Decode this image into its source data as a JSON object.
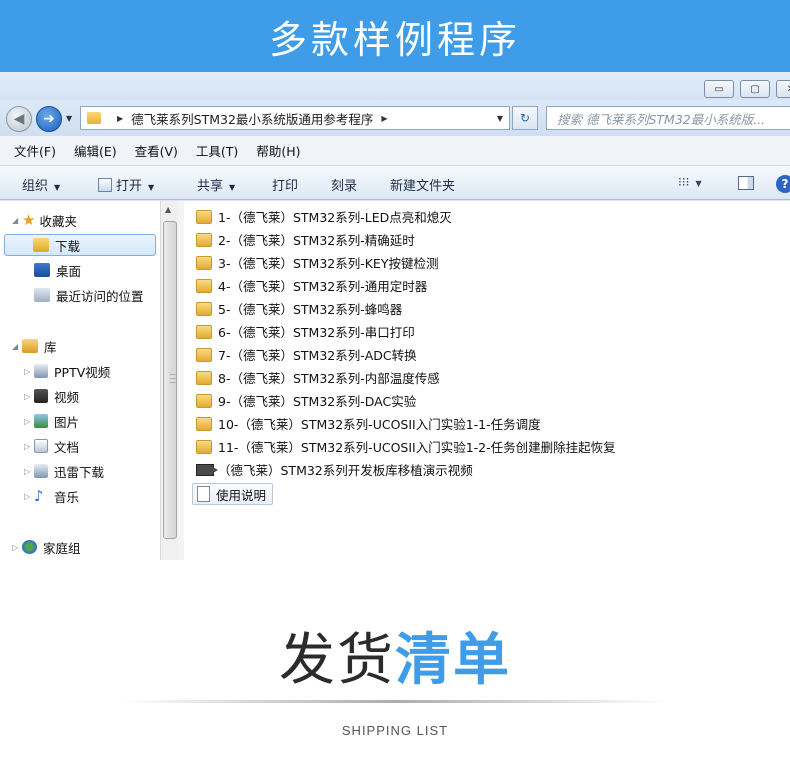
{
  "banner": {
    "title": "多款样例程序"
  },
  "window": {
    "controls": {
      "minimize": "▭",
      "maximize": "▢",
      "close": "✕"
    },
    "nav": {
      "back_icon": "◀",
      "forward_icon": "➜",
      "address_path": "德飞莱系列STM32最小系统版通用参考程序",
      "refresh_icon": "↻",
      "search_placeholder": "搜索 德飞莱系列STM32最小系统版..."
    },
    "menu": [
      "文件(F)",
      "编辑(E)",
      "查看(V)",
      "工具(T)",
      "帮助(H)"
    ],
    "commands": {
      "organize": "组织",
      "open": "打开",
      "share": "共享",
      "print": "打印",
      "burn": "刻录",
      "new_folder": "新建文件夹",
      "view_icon": "⁝⁝⁝",
      "help_icon": "?"
    },
    "sidebar": {
      "favorites": "收藏夹",
      "favorites_items": [
        "下载",
        "桌面",
        "最近访问的位置"
      ],
      "libraries": "库",
      "library_items": [
        "PPTV视频",
        "视频",
        "图片",
        "文档",
        "迅雷下载",
        "音乐"
      ],
      "homegroup": "家庭组"
    },
    "files": [
      "1-（德飞莱）STM32系列-LED点亮和熄灭",
      "2-（德飞莱）STM32系列-精确延时",
      "3-（德飞莱）STM32系列-KEY按键检测",
      "4-（德飞莱）STM32系列-通用定时器",
      "5-（德飞莱）STM32系列-蜂鸣器",
      "6-（德飞莱）STM32系列-串口打印",
      "7-（德飞莱）STM32系列-ADC转换",
      "8-（德飞莱）STM32系列-内部温度传感",
      "9-（德飞莱）STM32系列-DAC实验",
      "10-（德飞莱）STM32系列-UCOSII入门实验1-1-任务调度",
      "11-（德飞莱）STM32系列-UCOSII入门实验1-2-任务创建删除挂起恢复"
    ],
    "video_file": "（德飞莱）STM32系列开发板库移植演示视频",
    "doc_file": "使用说明"
  },
  "shipping": {
    "title_plain": "发货",
    "title_highlight": "清单",
    "subtitle": "SHIPPING LIST"
  },
  "colors": {
    "accent": "#3e9ce8"
  }
}
